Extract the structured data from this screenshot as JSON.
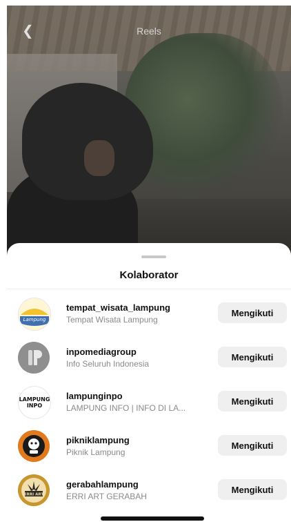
{
  "header": {
    "title": "Reels",
    "back_icon": "chevron-left-icon"
  },
  "sheet": {
    "title": "Kolaborator"
  },
  "collaborators": [
    {
      "username": "tempat_wisata_lampung",
      "subtitle": "Tempat Wisata Lampung",
      "button": "Mengikuti",
      "avatar_icon": "landscape-logo-icon",
      "avatar_color": "#f2c230"
    },
    {
      "username": "inpomediagroup",
      "subtitle": "Info Seluruh Indonesia",
      "button": "Mengikuti",
      "avatar_icon": "ip-logo-icon",
      "avatar_color": "#9a9a9a"
    },
    {
      "username": "lampunginpo",
      "subtitle": "LAMPUNG INFO | INFO DI LA...",
      "button": "Mengikuti",
      "avatar_icon": "text-logo-icon",
      "avatar_text": "LAMPUNG INPO",
      "avatar_color": "#ffffff"
    },
    {
      "username": "pikniklampung",
      "subtitle": "Piknik Lampung",
      "button": "Mengikuti",
      "avatar_icon": "mascot-logo-icon",
      "avatar_color": "#e07a1c"
    },
    {
      "username": "gerabahlampung",
      "subtitle": "ERRI ART GERABAH",
      "button": "Mengikuti",
      "avatar_icon": "erriart-logo-icon",
      "avatar_text": "ERRI ART",
      "avatar_color": "#c8962e"
    }
  ]
}
